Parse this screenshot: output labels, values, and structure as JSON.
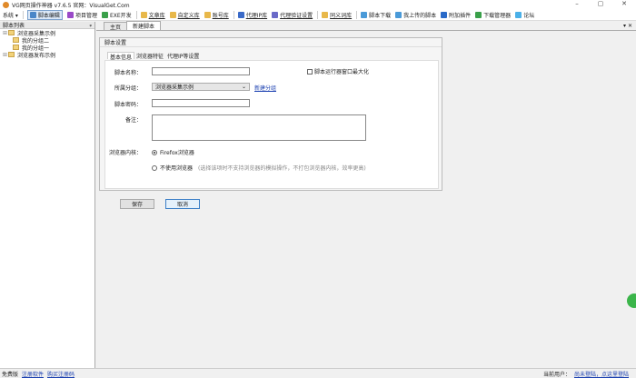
{
  "window": {
    "title": "VG网页操作神器 v7.6.5  官网：VisualGet.Com",
    "minimize": "–",
    "maximize": "▢",
    "close": "✕"
  },
  "toolbar": {
    "items": [
      {
        "label": "系统 ▾",
        "color": "#ffffff"
      },
      {
        "label": "脚本编辑",
        "color": "#4a86c8"
      },
      {
        "label": "项目管理",
        "color": "#9a4ac8"
      },
      {
        "label": "EXE开发",
        "color": "#3aa04a"
      },
      {
        "label": "文章库",
        "color": "#e8b84a"
      },
      {
        "label": "自定义库",
        "color": "#e8b84a"
      },
      {
        "label": "账号库",
        "color": "#e8b84a"
      },
      {
        "label": "代理IP库",
        "color": "#3a6ac8"
      },
      {
        "label": "代理验证设置",
        "color": "#6a6ac8"
      },
      {
        "label": "同义词库",
        "color": "#e8b84a"
      },
      {
        "label": "脚本下载",
        "color": "#4a9ad8"
      },
      {
        "label": "我上传的脚本",
        "color": "#4a9ad8"
      },
      {
        "label": "附加插件",
        "color": "#2a6ac8"
      },
      {
        "label": "下载管理器",
        "color": "#3aa04a"
      },
      {
        "label": "论坛",
        "color": "#4ab0e8"
      }
    ]
  },
  "sidebar": {
    "title": "脚本列表",
    "pin": "ᵩ",
    "items": [
      {
        "label": "浏览器采集示例",
        "exp": "⊞"
      },
      {
        "label": "我的分组二",
        "exp": ""
      },
      {
        "label": "我的分组一",
        "exp": ""
      },
      {
        "label": "浏览器发布示例",
        "exp": "⊞"
      }
    ]
  },
  "tabs": [
    {
      "label": "主页"
    },
    {
      "label": "新建脚本"
    }
  ],
  "tab_controls": "▾ ✕",
  "panel": {
    "title": "脚本设置",
    "subtabs": [
      "基本信息",
      "浏览器特征",
      "代理IP等设置"
    ]
  },
  "form": {
    "name_label": "脚本名称：",
    "name_value": "",
    "maximize_label": "脚本运行器窗口最大化",
    "group_label": "所属分组：",
    "group_value": "浏览器采集示例",
    "group_arrow": "⌄",
    "new_group": "新建分组",
    "password_label": "脚本密码：",
    "password_value": "",
    "note_label": "备注：",
    "note_value": "",
    "kernel_label": "浏览器内核：",
    "opt_firefox": "Firefox浏览器",
    "opt_none": "不使用浏览器",
    "opt_none_hint": "(选择该项时不支持浏览器的模拟操作，不打包浏览器内核，效率更高)"
  },
  "buttons": {
    "save": "保存",
    "cancel": "取消"
  },
  "status": {
    "edition": "免费版",
    "register": "注册软件",
    "buy": "购买注册码",
    "user_label": "当前用户：",
    "login": "尚未登陆，点这里登陆"
  }
}
